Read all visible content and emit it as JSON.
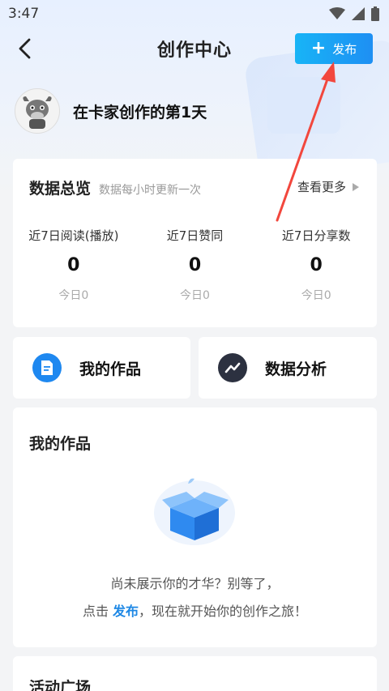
{
  "status_bar": {
    "time": "3:47"
  },
  "header": {
    "title": "创作中心",
    "publish_label": "发布"
  },
  "profile": {
    "text": "在卡家创作的第1天"
  },
  "stats": {
    "title": "数据总览",
    "subtitle": "数据每小时更新一次",
    "more_label": "查看更多",
    "items": [
      {
        "label": "近7日阅读(播放)",
        "value": "0",
        "today": "今日0"
      },
      {
        "label": "近7日赞同",
        "value": "0",
        "today": "今日0"
      },
      {
        "label": "近7日分享数",
        "value": "0",
        "today": "今日0"
      }
    ]
  },
  "shortcuts": {
    "works_label": "我的作品",
    "analytics_label": "数据分析"
  },
  "works": {
    "title": "我的作品",
    "empty_line1": "尚未展示你的才华？别等了，",
    "empty_line2_prefix": "点击 ",
    "empty_line2_link": "发布",
    "empty_line2_suffix": "，现在就开始你的创作之旅！"
  },
  "activity": {
    "title": "活动广场"
  },
  "colors": {
    "accent": "#1e8ff3",
    "annotation_arrow": "#f2473d"
  },
  "icons": {
    "works": "document-icon",
    "analytics": "trend-line-icon"
  }
}
